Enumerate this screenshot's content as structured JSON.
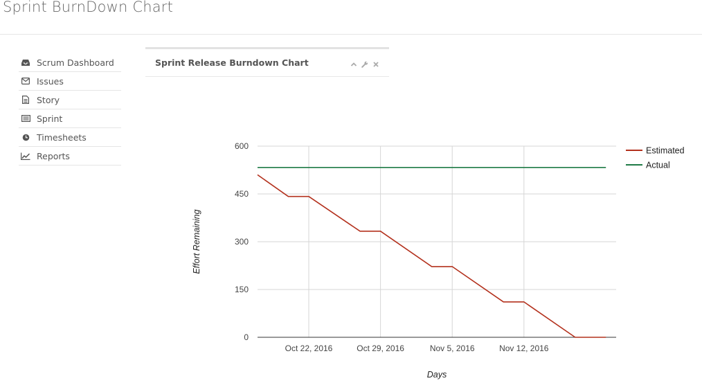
{
  "page": {
    "title": "Sprint BurnDown Chart"
  },
  "sidebar": {
    "items": [
      {
        "label": "Scrum Dashboard",
        "icon": "inbox-icon"
      },
      {
        "label": "Issues",
        "icon": "envelope-icon"
      },
      {
        "label": "Story",
        "icon": "file-text-icon"
      },
      {
        "label": "Sprint",
        "icon": "list-alt-icon"
      },
      {
        "label": "Timesheets",
        "icon": "clock-icon"
      },
      {
        "label": "Reports",
        "icon": "line-chart-icon"
      }
    ]
  },
  "widget": {
    "title": "Sprint Release Burndown Chart",
    "tools": [
      "chevron-up-icon",
      "wrench-icon",
      "close-icon"
    ]
  },
  "chart_data": {
    "type": "line",
    "xlabel": "Days",
    "ylabel": "Effort Remaining",
    "ylim": [
      0,
      600
    ],
    "yticks": [
      0,
      150,
      300,
      450,
      600
    ],
    "xlim": [
      "2016-10-17",
      "2016-11-21"
    ],
    "xticks": [
      {
        "value": "2016-10-22",
        "label": "Oct 22, 2016"
      },
      {
        "value": "2016-10-29",
        "label": "Oct 29, 2016"
      },
      {
        "value": "2016-11-05",
        "label": "Nov 5, 2016"
      },
      {
        "value": "2016-11-12",
        "label": "Nov 12, 2016"
      }
    ],
    "grid": true,
    "legend": "right",
    "series": [
      {
        "name": "Estimated",
        "color": "#b3301c",
        "points": [
          [
            "2016-10-17",
            510
          ],
          [
            "2016-10-20",
            442
          ],
          [
            "2016-10-22",
            442
          ],
          [
            "2016-10-27",
            333
          ],
          [
            "2016-10-29",
            333
          ],
          [
            "2016-11-03",
            222
          ],
          [
            "2016-11-05",
            222
          ],
          [
            "2016-11-10",
            111
          ],
          [
            "2016-11-12",
            111
          ],
          [
            "2016-11-17",
            0
          ],
          [
            "2016-11-20",
            0
          ]
        ]
      },
      {
        "name": "Actual",
        "color": "#1e7a45",
        "points": [
          [
            "2016-10-17",
            533
          ],
          [
            "2016-11-20",
            533
          ]
        ]
      }
    ]
  }
}
